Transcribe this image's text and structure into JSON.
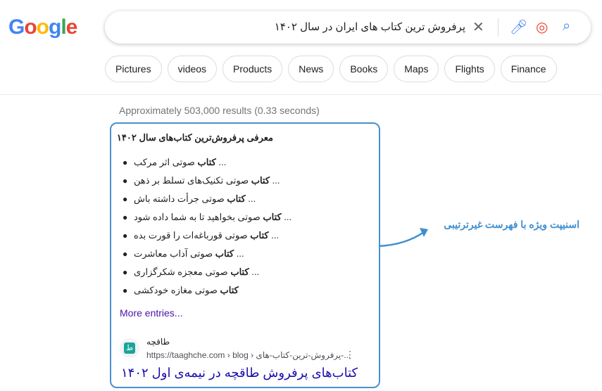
{
  "logo": "Google",
  "search": {
    "query": "پرفروش ترین کتاب های ایران در سال ۱۴۰۲"
  },
  "chips": [
    "Pictures",
    "videos",
    "Products",
    "News",
    "Books",
    "Maps",
    "Flights",
    "Finance"
  ],
  "stats": "Approximately 503,000 results (0.33 seconds)",
  "snippet": {
    "title": "معرفی پرفروش‌ترین کتاب‌های سال ۱۴۰۲",
    "items": [
      {
        "bold": "کتاب",
        "rest": " صوتی اثر مرکب",
        "ellipsis": "... "
      },
      {
        "bold": "کتاب",
        "rest": " صوتی تکنیک‌های تسلط بر ذهن",
        "ellipsis": "... "
      },
      {
        "bold": "کتاب",
        "rest": " صوتی جرأت داشته باش",
        "ellipsis": "... "
      },
      {
        "bold": "کتاب",
        "rest": " صوتی بخواهید تا به شما داده شود",
        "ellipsis": "... "
      },
      {
        "bold": "کتاب",
        "rest": " صوتی قورباغه‌ات را قورت بده",
        "ellipsis": "... "
      },
      {
        "bold": "کتاب",
        "rest": " صوتی آداب معاشرت",
        "ellipsis": "... "
      },
      {
        "bold": "کتاب",
        "rest": " صوتی معجزه شکرگزاری",
        "ellipsis": "... "
      },
      {
        "bold": "کتاب",
        "rest": " صوتی مغازه خودکشی",
        "ellipsis": ""
      }
    ],
    "more": "More entries...",
    "site_name": "طاقچه",
    "url": "https://taaghche.com › blog › پرفروش-ترین-کتاب-های-...",
    "result_title": "کتاب‌های پرفروش طاقچه در نیمه‌ی اول ۱۴۰۲"
  },
  "annotation": "اسنیپت ویژه با فهرست غیرترتیبی",
  "colors": {
    "annotation": "#3f8fd0",
    "link": "#1a0dab"
  }
}
